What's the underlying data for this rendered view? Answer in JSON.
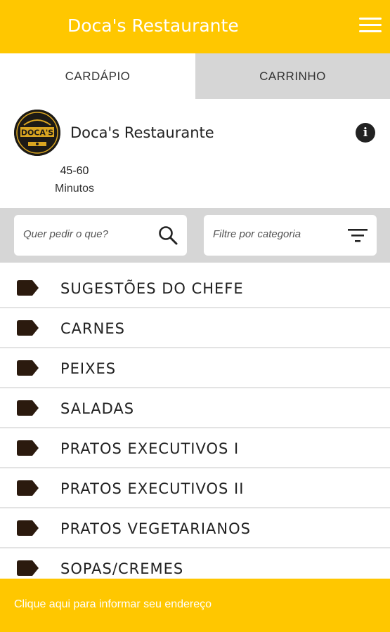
{
  "appbar": {
    "title": "Doca's Restaurante",
    "menu_icon": "hamburger-menu-icon"
  },
  "tabs": [
    {
      "label": "CARDÁPIO",
      "active": true
    },
    {
      "label": "CARRINHO",
      "active": false
    }
  ],
  "restaurant": {
    "name": "Doca's Restaurante",
    "logo_text": "DOCA'S",
    "delivery_time": "45-60",
    "delivery_unit": "Minutos",
    "info_icon": "info-icon"
  },
  "search": {
    "placeholder": "Quer pedir o que?",
    "icon": "search-icon"
  },
  "filter": {
    "placeholder": "Filtre por categoria",
    "icon": "filter-icon"
  },
  "categories": [
    "SUGESTÕES DO CHEFE",
    "CARNES",
    "PEIXES",
    "SALADAS",
    "PRATOS EXECUTIVOS I",
    "PRATOS EXECUTIVOS II",
    "PRATOS VEGETARIANOS",
    "SOPAS/CREMES"
  ],
  "bottom_bar": {
    "label": "Clique aqui para informar seu endereço"
  },
  "colors": {
    "accent": "#FFC700",
    "tag": "#2b1a0e",
    "tab_inactive": "#d6d6d6"
  }
}
